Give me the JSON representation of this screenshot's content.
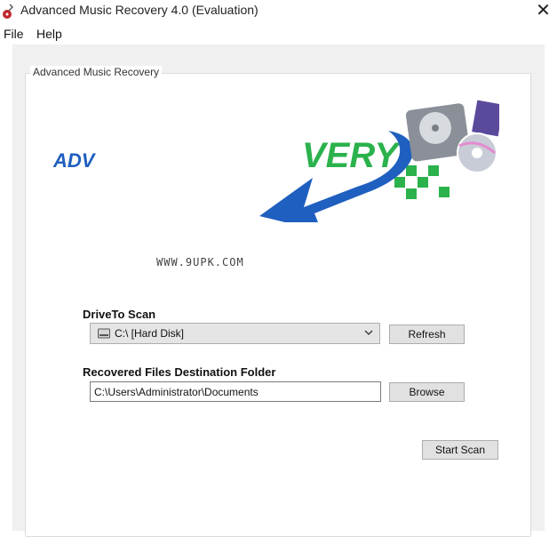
{
  "window": {
    "title": "Advanced Music Recovery 4.0 (Evaluation)",
    "close_glyph": "✕",
    "icon": "guitar-app-icon"
  },
  "menu": [
    {
      "label": "File"
    },
    {
      "label": "Help"
    }
  ],
  "group": {
    "legend": "Advanced Music Recovery"
  },
  "banner": {
    "text_left": "ADV",
    "text_right": "VERY",
    "watermark": "WWW.9UPK.COM",
    "colors": {
      "green": "#2bb24c",
      "blue": "#1f5fbf"
    }
  },
  "drive": {
    "label": "DriveTo Scan",
    "selected": "C:\\ [Hard Disk]",
    "refresh_label": "Refresh"
  },
  "destination": {
    "label": "Recovered Files Destination Folder",
    "value": "C:\\Users\\Administrator\\Documents",
    "browse_label": "Browse"
  },
  "actions": {
    "start_label": "Start Scan"
  }
}
